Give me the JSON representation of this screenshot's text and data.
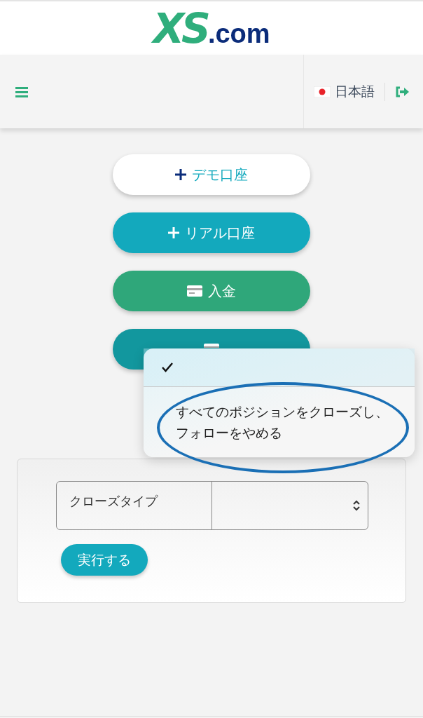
{
  "logo": {
    "mark": "XS",
    "suffix": ".com"
  },
  "navbar": {
    "language": "日本語"
  },
  "actions": [
    {
      "label": "デモ口座",
      "kind": "add",
      "color": "#ffffff"
    },
    {
      "label": "リアル口座",
      "kind": "add",
      "color": "#13a9bd"
    },
    {
      "label": "入金",
      "kind": "money",
      "color": "#2fa77a"
    },
    {
      "kind": "money",
      "color": "#12979e"
    }
  ],
  "dropdown_menu": {
    "options": [
      {
        "selected": true
      },
      {
        "label": "すべてのポジションをクローズし、フォローをやめる",
        "selected": false,
        "circled": true
      }
    ]
  },
  "form": {
    "field_label": "クローズタイプ",
    "submit": "実行する"
  }
}
